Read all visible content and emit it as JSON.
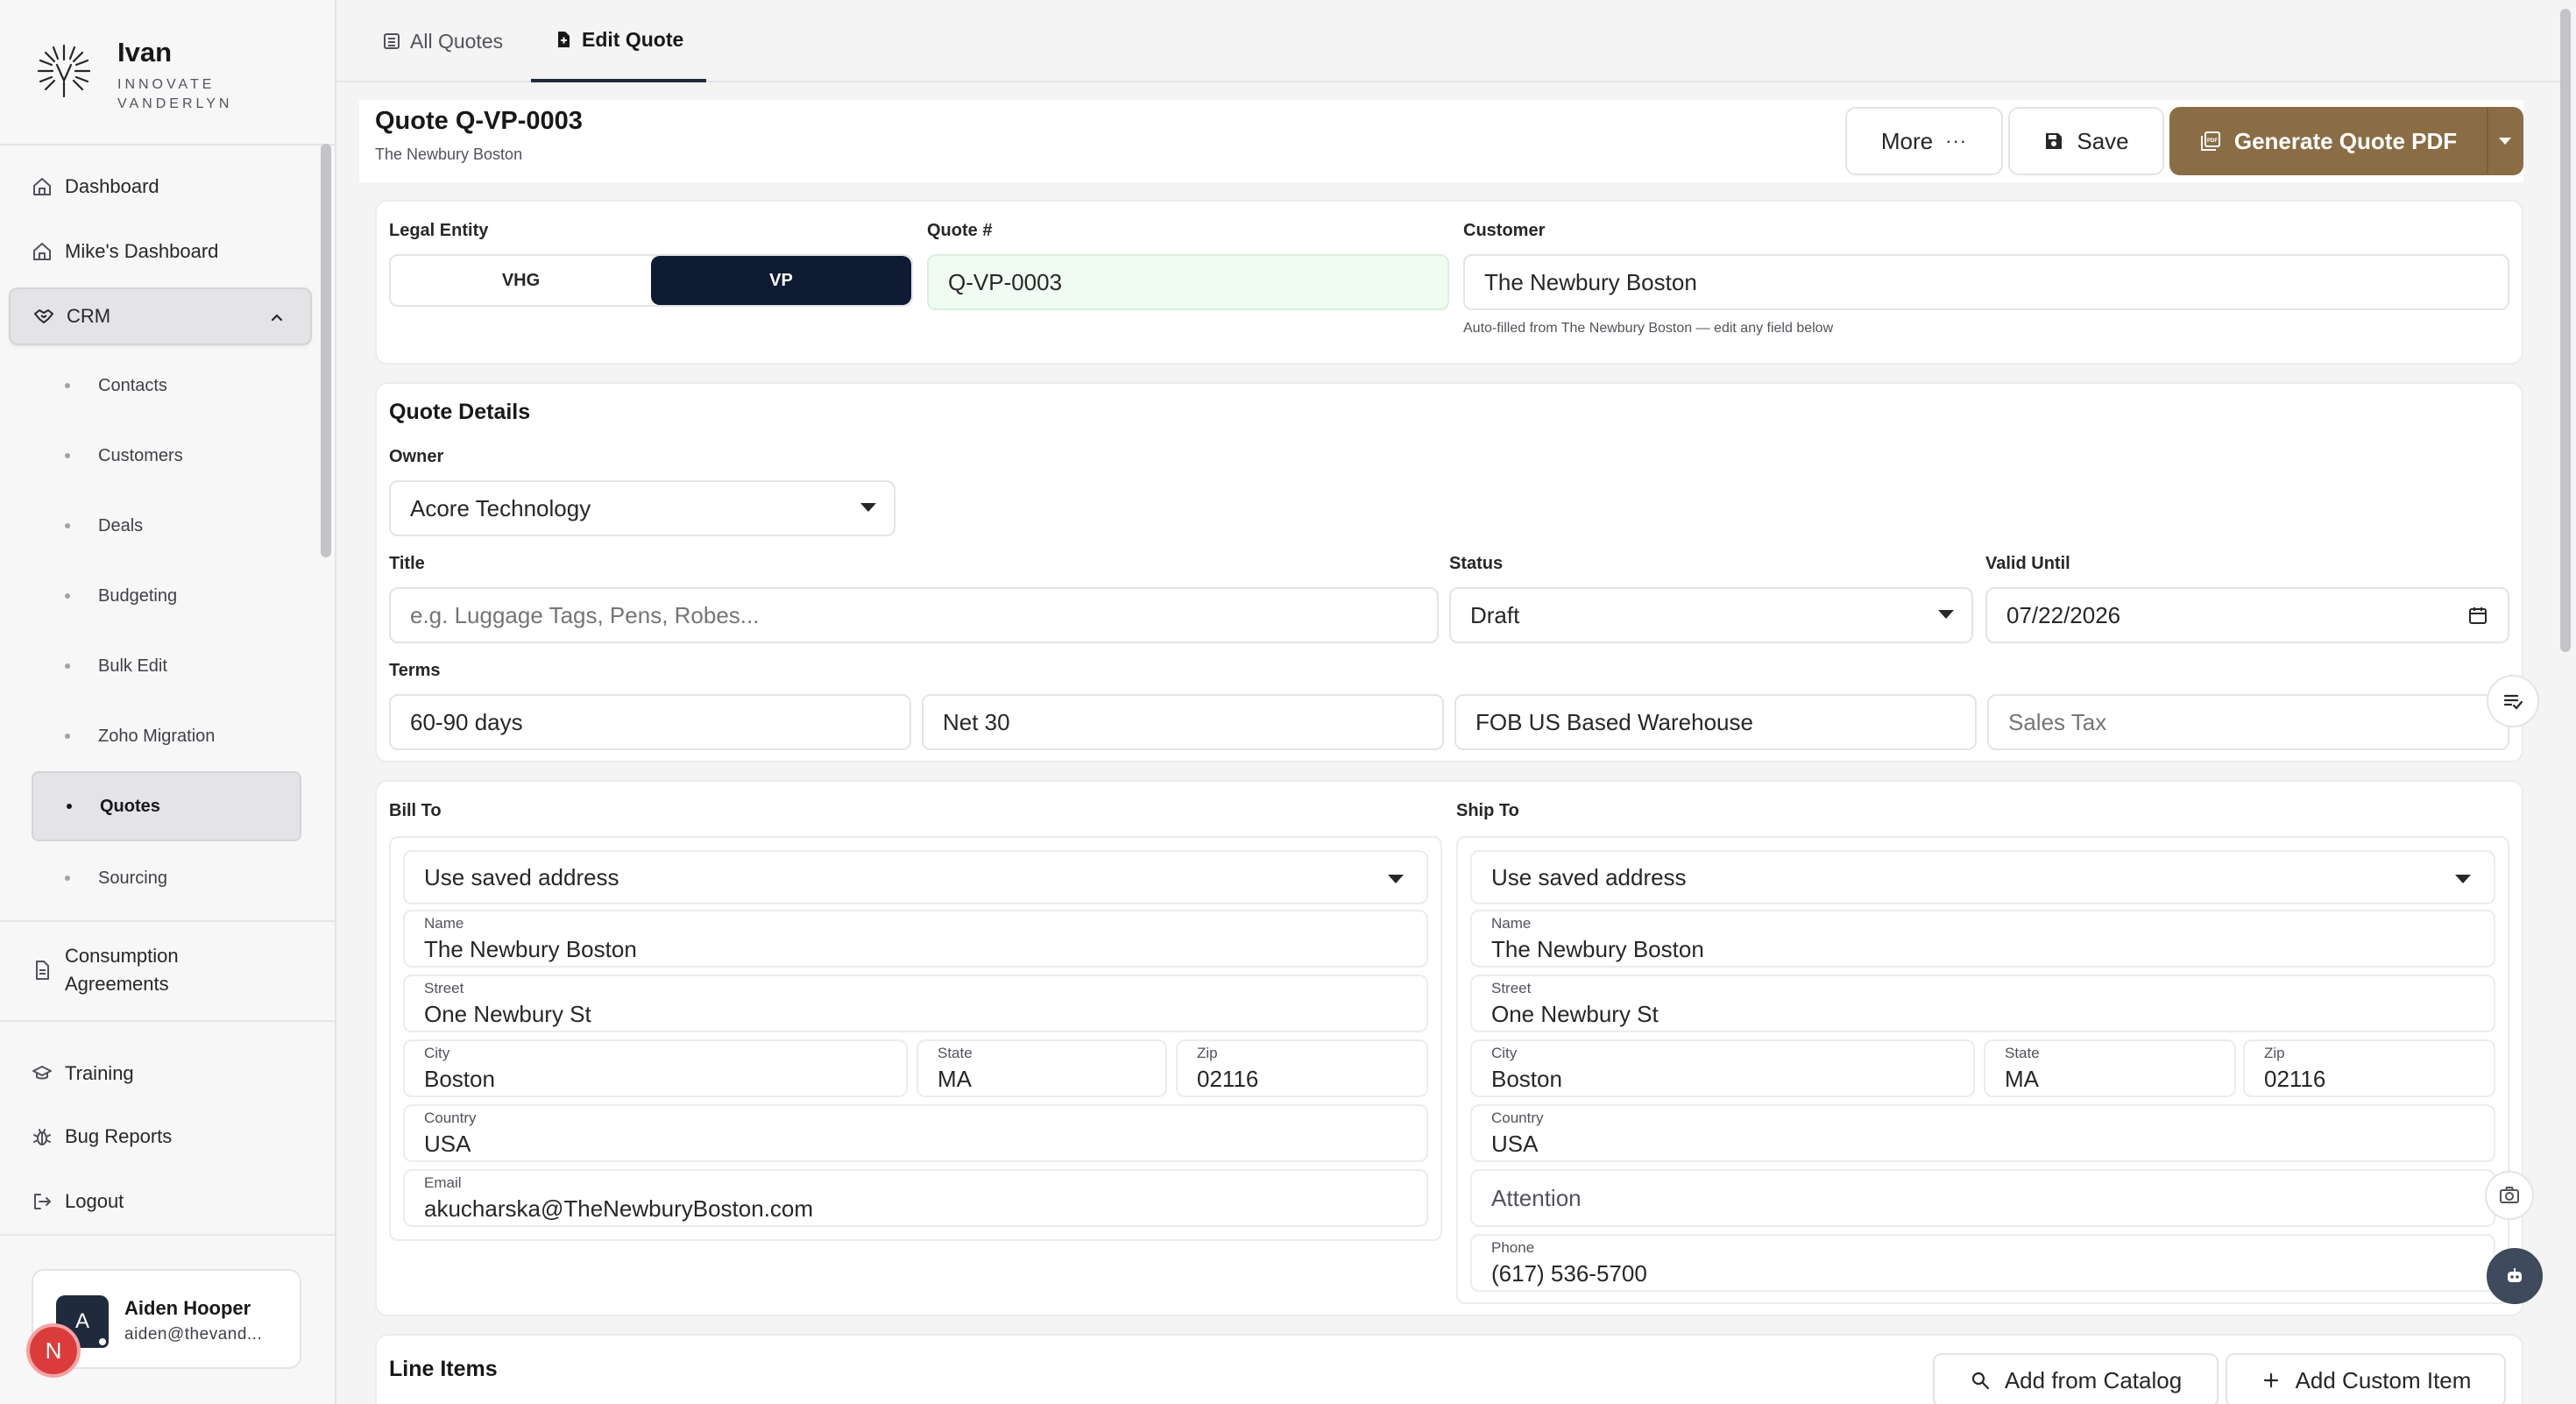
{
  "brand": {
    "name": "Ivan",
    "sub_line1": "INNOVATE",
    "sub_line2": "VANDERLYN"
  },
  "sidebar": {
    "items": [
      {
        "label": "Dashboard",
        "icon": "home-icon"
      },
      {
        "label": "Mike's Dashboard",
        "icon": "home-icon"
      },
      {
        "label": "CRM",
        "icon": "handshake-icon"
      }
    ],
    "crm_children": [
      "Contacts",
      "Customers",
      "Deals",
      "Budgeting",
      "Bulk Edit",
      "Zoho Migration",
      "Quotes",
      "Sourcing"
    ],
    "active_child": "Quotes",
    "consumption_line1": "Consumption",
    "consumption_line2": "Agreements",
    "bottom_items": [
      {
        "label": "Training",
        "icon": "graduation-cap-icon"
      },
      {
        "label": "Bug Reports",
        "icon": "bug-icon"
      },
      {
        "label": "Logout",
        "icon": "logout-icon"
      }
    ]
  },
  "user": {
    "initial": "A",
    "name": "Aiden Hooper",
    "email": "aiden@thevand..."
  },
  "notification": {
    "initial": "N"
  },
  "tabs": {
    "all_quotes": "All Quotes",
    "edit_quote": "Edit Quote"
  },
  "header": {
    "title": "Quote Q-VP-0003",
    "subtitle": "The Newbury Boston",
    "more_label": "More",
    "more_dots": "···",
    "save_label": "Save",
    "generate_label": "Generate Quote PDF"
  },
  "entity": {
    "legal_entity_label": "Legal Entity",
    "options": [
      "VHG",
      "VP"
    ],
    "selected": "VP",
    "quote_no_label": "Quote #",
    "quote_no": "Q-VP-0003",
    "customer_label": "Customer",
    "customer": "The Newbury Boston",
    "customer_hint": "Auto-filled from The Newbury Boston — edit any field below"
  },
  "details": {
    "section_title": "Quote Details",
    "owner_label": "Owner",
    "owner": "Acore Technology",
    "title_label": "Title",
    "title_placeholder": "e.g. Luggage Tags, Pens, Robes...",
    "status_label": "Status",
    "status": "Draft",
    "valid_until_label": "Valid Until",
    "valid_until": "07/22/2026",
    "terms_label": "Terms",
    "terms_lead_time": "60-90 days",
    "terms_payment": "Net 30",
    "terms_shipping": "FOB US Based Warehouse",
    "sales_tax_placeholder": "Sales Tax"
  },
  "bill_to": {
    "label": "Bill To",
    "saved_address": "Use saved address",
    "name_label": "Name",
    "name": "The Newbury Boston",
    "street_label": "Street",
    "street": "One Newbury St",
    "city_label": "City",
    "city": "Boston",
    "state_label": "State",
    "state": "MA",
    "zip_label": "Zip",
    "zip": "02116",
    "country_label": "Country",
    "country": "USA",
    "email_label": "Email",
    "email": "akucharska@TheNewburyBoston.com"
  },
  "ship_to": {
    "label": "Ship To",
    "saved_address": "Use saved address",
    "name_label": "Name",
    "name": "The Newbury Boston",
    "street_label": "Street",
    "street": "One Newbury St",
    "city_label": "City",
    "city": "Boston",
    "state_label": "State",
    "state": "MA",
    "zip_label": "Zip",
    "zip": "02116",
    "country_label": "Country",
    "country": "USA",
    "attention_placeholder": "Attention",
    "phone_label": "Phone",
    "phone": "(617) 536-5700"
  },
  "line_items": {
    "section_title": "Line Items",
    "add_catalog": "Add from Catalog",
    "add_custom": "Add Custom Item"
  },
  "colors": {
    "accent": "#8a6d45",
    "navy": "#0f1a33",
    "notification": "#dc3b3b"
  }
}
